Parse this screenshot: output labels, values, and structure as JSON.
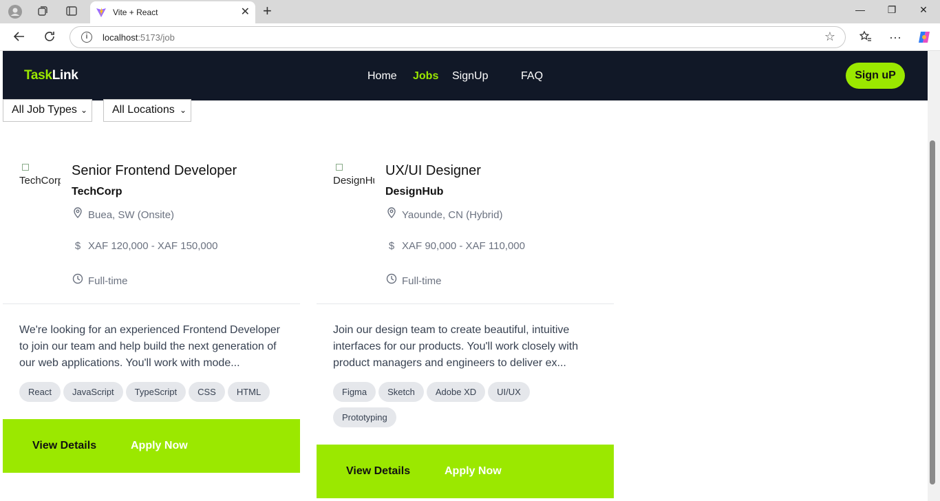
{
  "browser": {
    "tab_title": "Vite + React",
    "url_host": "localhost",
    "url_rest": ":5173/job"
  },
  "header": {
    "logo_accent": "Task",
    "logo_rest": "Link",
    "nav": [
      "Home",
      "Jobs",
      "SignUp",
      "FAQ"
    ],
    "active_nav": "Jobs",
    "signup_button": "Sign uP"
  },
  "filters": {
    "job_type": "All Job Types",
    "location": "All Locations"
  },
  "jobs": [
    {
      "logo_alt": "TechCorp",
      "title": "Senior Frontend Developer",
      "company": "TechCorp",
      "location": "Buea, SW (Onsite)",
      "salary": "XAF 120,000 - XAF 150,000",
      "type": "Full-time",
      "description": "We're looking for an experienced Frontend Developer to join our team and help build the next generation of our web applications. You'll work with mode...",
      "tags": [
        "React",
        "JavaScript",
        "TypeScript",
        "CSS",
        "HTML"
      ],
      "view_details": "View Details",
      "apply_now": "Apply Now"
    },
    {
      "logo_alt": "DesignHub",
      "title": "UX/UI Designer",
      "company": "DesignHub",
      "location": "Yaounde, CN (Hybrid)",
      "salary": "XAF 90,000 - XAF 110,000",
      "type": "Full-time",
      "description": "Join our design team to create beautiful, intuitive interfaces for our products. You'll work closely with product managers and engineers to deliver ex...",
      "tags": [
        "Figma",
        "Sketch",
        "Adobe XD",
        "UI/UX",
        "Prototyping"
      ],
      "view_details": "View Details",
      "apply_now": "Apply Now"
    }
  ],
  "colors": {
    "brand_green": "#9be800",
    "header_bg": "#111827"
  }
}
